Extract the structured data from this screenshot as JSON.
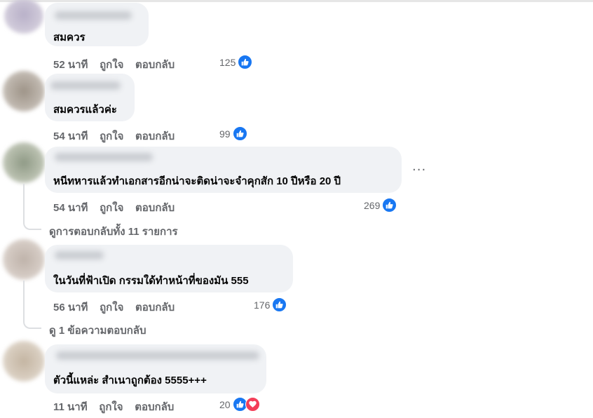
{
  "comments": [
    {
      "text": "สมควร",
      "time": "52 นาที",
      "like": "ถูกใจ",
      "reply": "ตอบกลับ",
      "reactions": "125"
    },
    {
      "text": "สมควรแล้วค่ะ",
      "time": "54 นาที",
      "like": "ถูกใจ",
      "reply": "ตอบกลับ",
      "reactions": "99"
    },
    {
      "text": "หนีทหารแล้วทำเอกสารอีกน่าจะติดน่าจะจำคุกสัก 10 ปีหรือ 20 ปี",
      "time": "54 นาที",
      "like": "ถูกใจ",
      "reply": "ตอบกลับ",
      "reactions": "269",
      "view_replies": "ดูการตอบกลับทั้ง 11 รายการ",
      "more": "···"
    },
    {
      "text": "ในวันที่ฟ้าเปิด กรรมใด้ทำหน้าที่ของมัน 555",
      "time": "56 นาที",
      "like": "ถูกใจ",
      "reply": "ตอบกลับ",
      "reactions": "176",
      "view_replies": "ดู 1 ข้อความตอบกลับ"
    },
    {
      "text": "ตัวนี้แหล่ะ สำเนาถูกต้อง 5555+++",
      "time": "11 นาที",
      "like": "ถูกใจ",
      "reply": "ตอบกลับ",
      "reactions": "20"
    }
  ],
  "icons": {
    "like": "thumbs-up-icon",
    "love": "heart-icon",
    "more": "more-options-icon"
  },
  "colors": {
    "like_blue": "#1877f2",
    "love_red": "#f33e58",
    "bubble": "#f0f2f5",
    "meta_gray": "#65676b"
  }
}
